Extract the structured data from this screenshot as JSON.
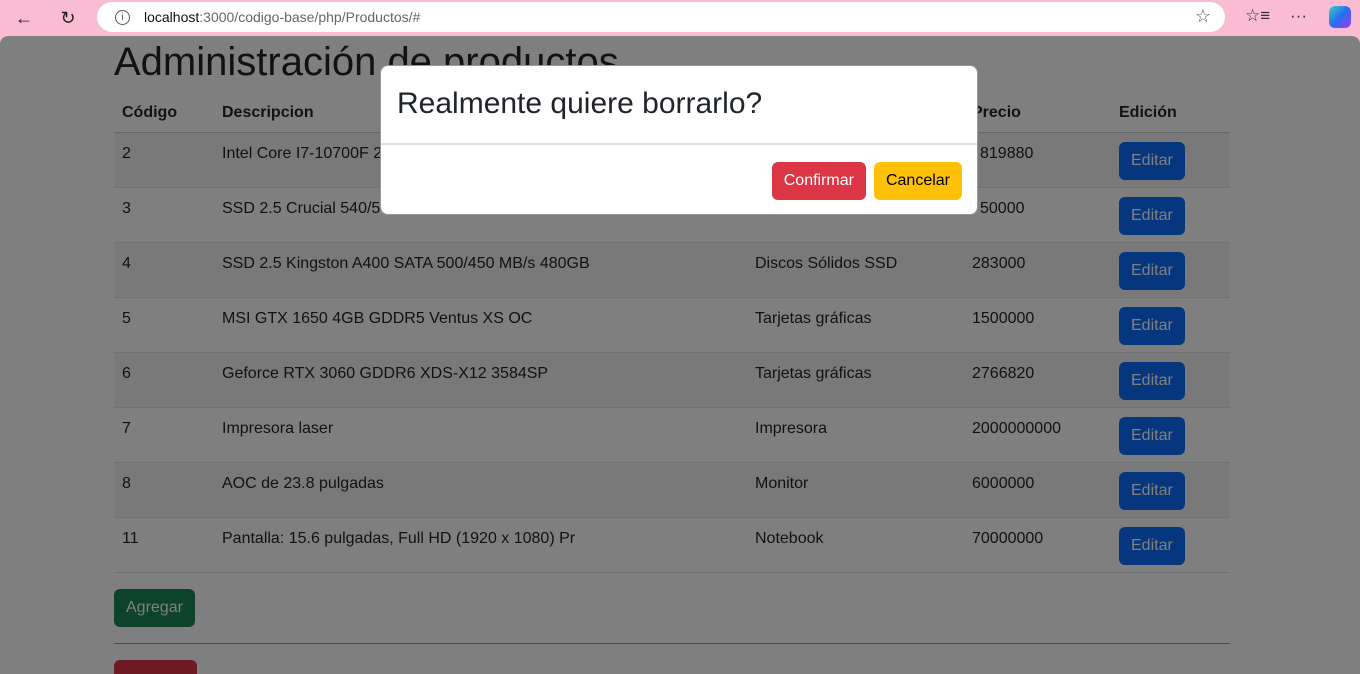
{
  "browser": {
    "url_host": "localhost",
    "url_path": ":3000/codigo-base/php/Productos/#"
  },
  "page": {
    "title": "Administración de productos"
  },
  "table": {
    "headers": [
      "Código",
      "Descripcion",
      "",
      "Precio",
      "Edición"
    ],
    "rows": [
      {
        "codigo": "2",
        "descripcion": "Intel Core I7-10700F 2.",
        "categoria": "",
        "precio": "819880",
        "edit": "Editar"
      },
      {
        "codigo": "3",
        "descripcion": "SSD 2.5 Crucial 540/50",
        "categoria": "",
        "precio": "50000",
        "edit": "Editar"
      },
      {
        "codigo": "4",
        "descripcion": "SSD 2.5 Kingston A400 SATA 500/450 MB/s 480GB",
        "categoria": "Discos Sólidos SSD",
        "precio": "283000",
        "edit": "Editar"
      },
      {
        "codigo": "5",
        "descripcion": "MSI GTX 1650 4GB GDDR5 Ventus XS OC",
        "categoria": "Tarjetas gráficas",
        "precio": "1500000",
        "edit": "Editar"
      },
      {
        "codigo": "6",
        "descripcion": "Geforce RTX 3060 GDDR6 XDS-X12 3584SP",
        "categoria": "Tarjetas gráficas",
        "precio": "2766820",
        "edit": "Editar"
      },
      {
        "codigo": "7",
        "descripcion": "Impresora laser",
        "categoria": "Impresora",
        "precio": "2000000000",
        "edit": "Editar"
      },
      {
        "codigo": "8",
        "descripcion": "AOC de 23.8 pulgadas",
        "categoria": "Monitor",
        "precio": "6000000",
        "edit": "Editar"
      },
      {
        "codigo": "11",
        "descripcion": "Pantalla: 15.6 pulgadas, Full HD (1920 x 1080) Pr",
        "categoria": "Notebook",
        "precio": "70000000",
        "edit": "Editar"
      }
    ]
  },
  "actions": {
    "add": "Agregar"
  },
  "modal": {
    "title": "Realmente quiere borrarlo?",
    "confirm": "Confirmar",
    "cancel": "Cancelar"
  }
}
